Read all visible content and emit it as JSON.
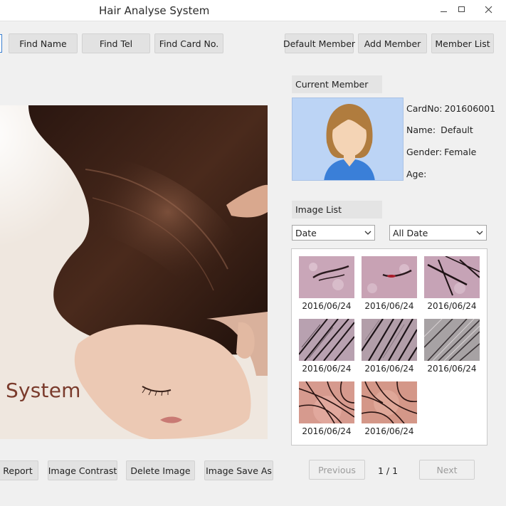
{
  "window": {
    "title": "Hair Analyse System"
  },
  "toolbar": {
    "find_name": "Find Name",
    "find_tel": "Find Tel",
    "find_card": "Find Card No.",
    "default_member": "Default Member",
    "add_member": "Add Member",
    "member_list": "Member List"
  },
  "main_image": {
    "overlay_text": "System"
  },
  "current_member": {
    "label": "Current Member",
    "fields": [
      {
        "key": "CardNo:",
        "value": "201606001"
      },
      {
        "key": "Name:",
        "value": "Default"
      },
      {
        "key": "Gender:",
        "value": "Female"
      },
      {
        "key": "Age:",
        "value": ""
      }
    ]
  },
  "image_list": {
    "label": "Image List",
    "filter_type": "Date",
    "filter_range": "All Date",
    "thumbnails": [
      {
        "date": "2016/06/24"
      },
      {
        "date": "2016/06/24"
      },
      {
        "date": "2016/06/24"
      },
      {
        "date": "2016/06/24"
      },
      {
        "date": "2016/06/24"
      },
      {
        "date": "2016/06/24"
      },
      {
        "date": "2016/06/24"
      },
      {
        "date": "2016/06/24"
      }
    ]
  },
  "bottom_bar": {
    "report": "Report",
    "image_contrast": "Image Contrast",
    "delete_image": "Delete Image",
    "image_save_as": "Image Save As"
  },
  "pagination": {
    "previous": "Previous",
    "page": "1 / 1",
    "next": "Next"
  }
}
